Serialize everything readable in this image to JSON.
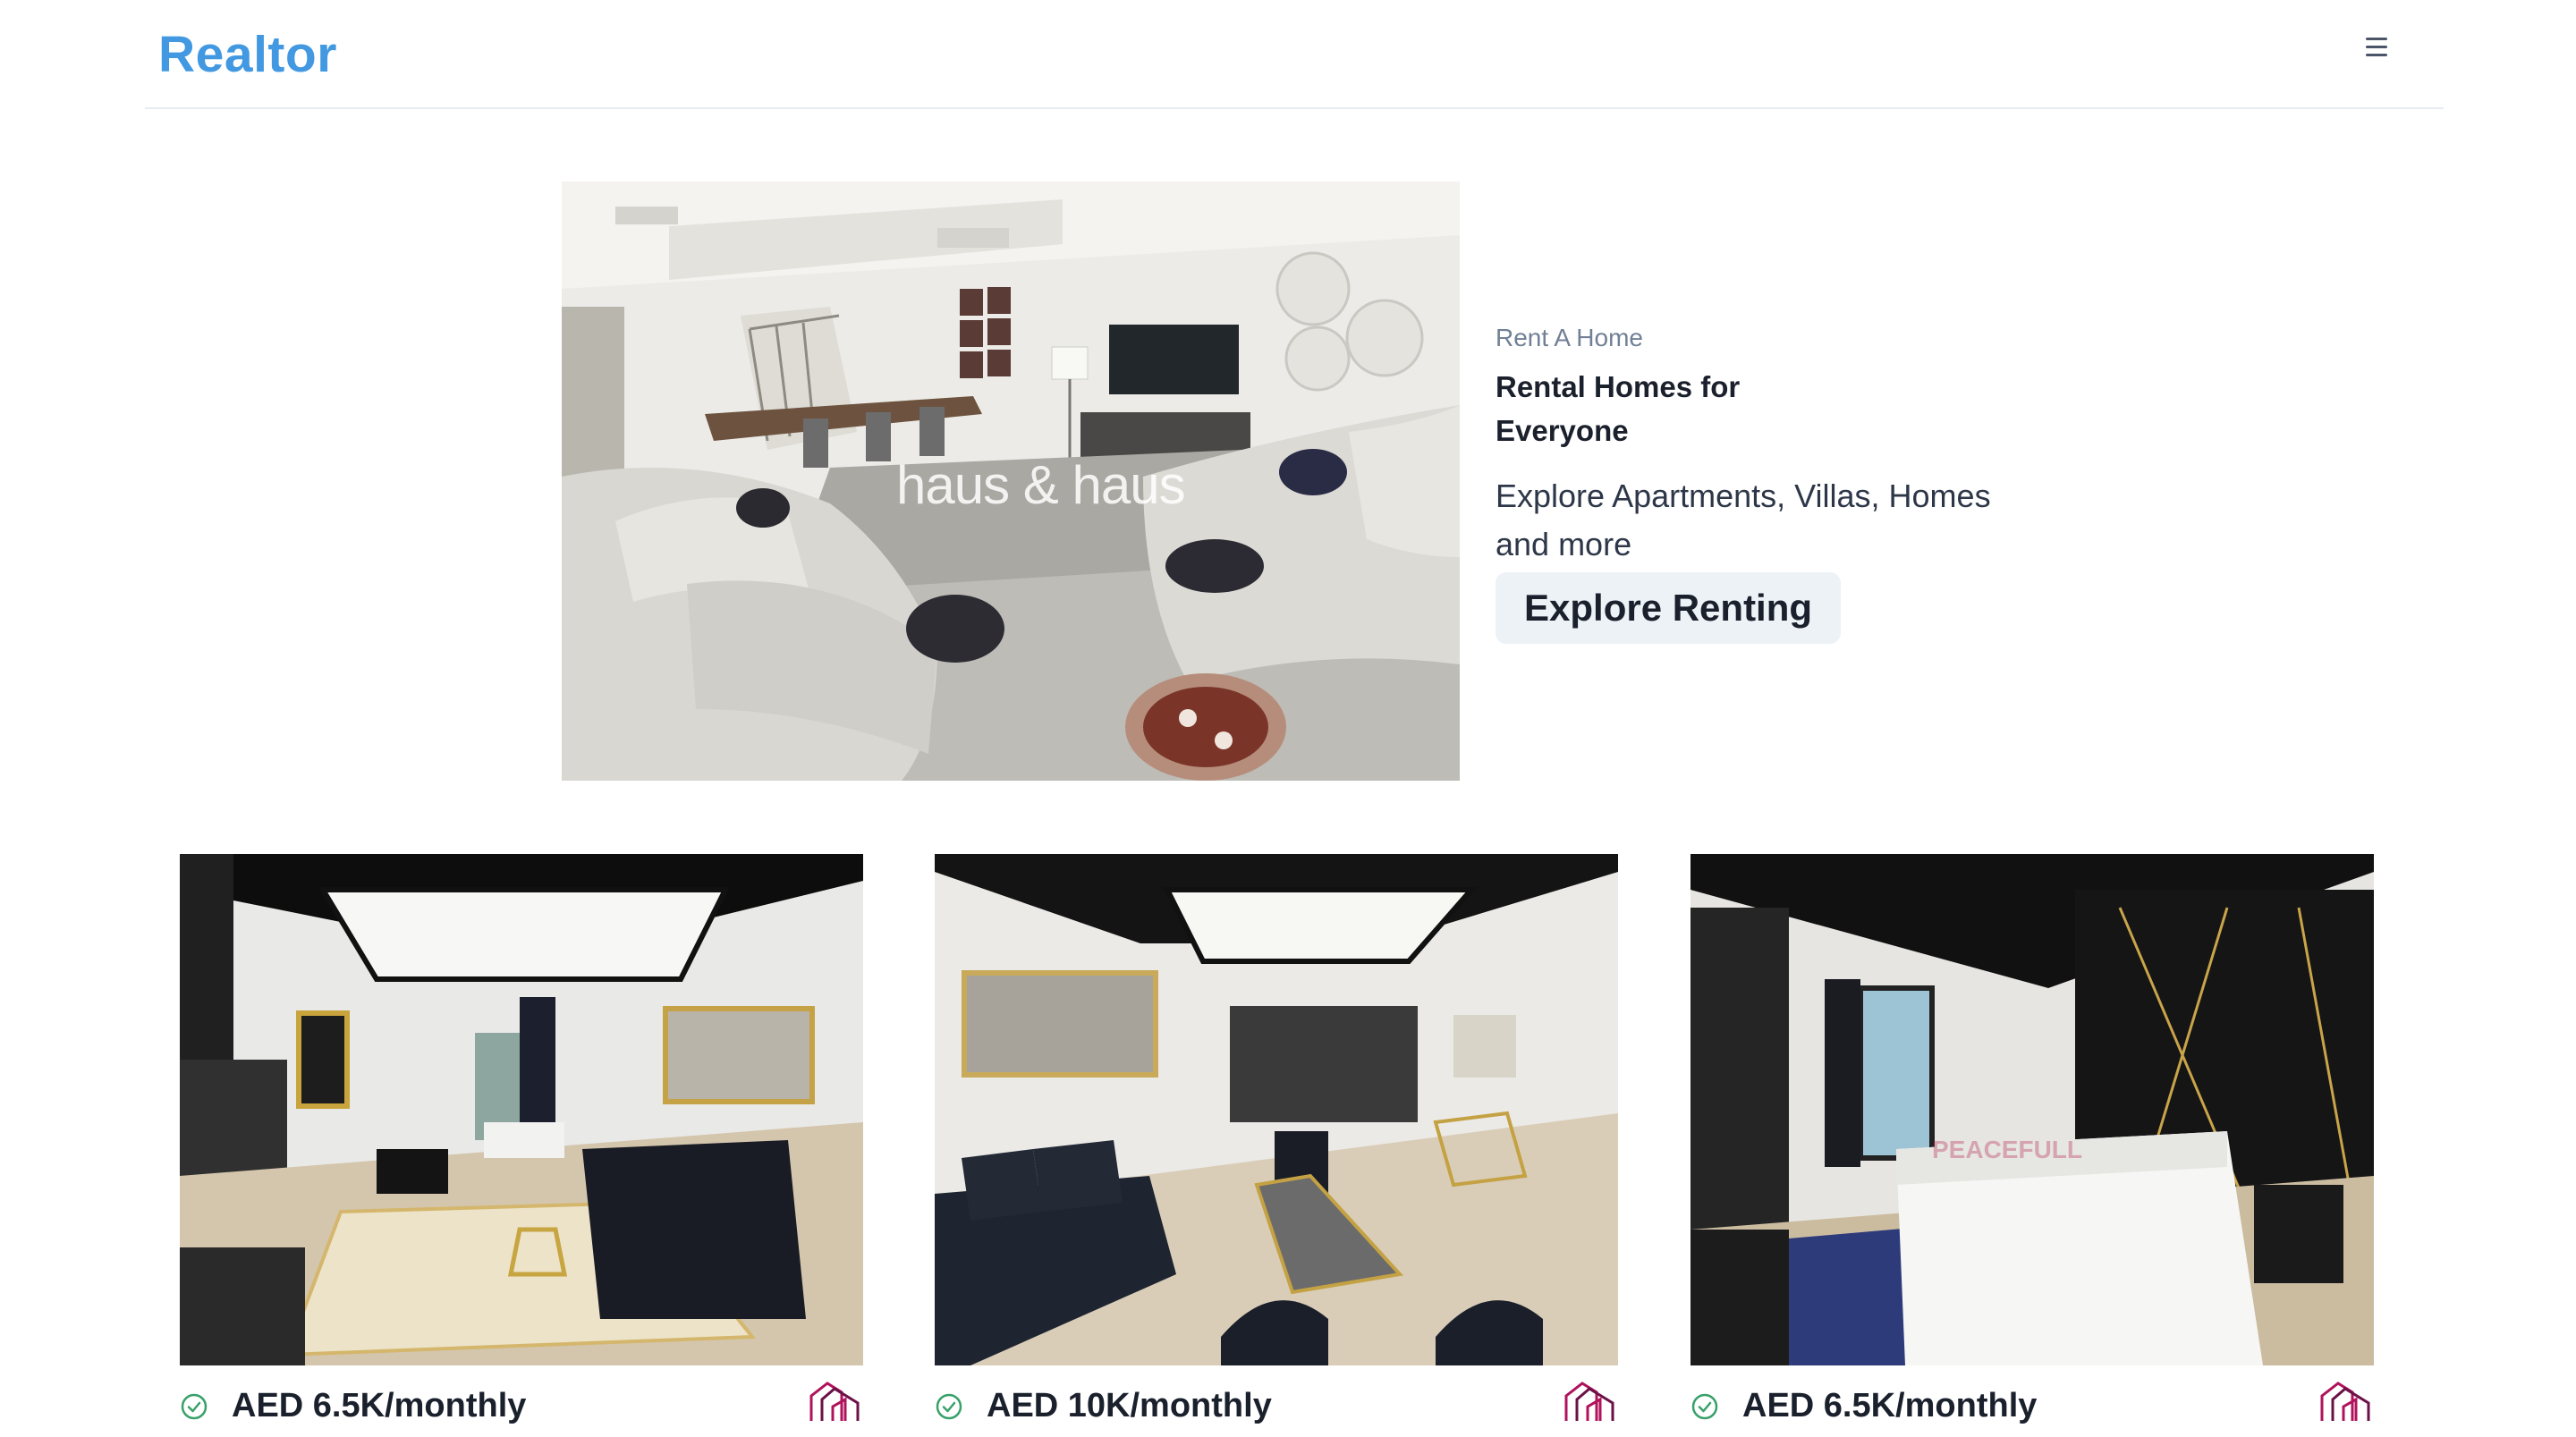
{
  "nav": {
    "brand": "Realtor",
    "menu_icon": "hamburger-menu-icon"
  },
  "hero": {
    "image_watermark": "haus & haus",
    "eyebrow": "Rent A Home",
    "title": "Rental Homes for Everyone",
    "description": "Explore Apartments, Villas, Homes and more",
    "button_label": "Explore Renting"
  },
  "listings": [
    {
      "price": "AED 6.5K/monthly",
      "verified_icon": "check-circle-icon",
      "agency_logo": "safeful-logo"
    },
    {
      "price": "AED 10K/monthly",
      "verified_icon": "check-circle-icon",
      "agency_logo": "safeful-logo"
    },
    {
      "price": "AED 6.5K/monthly",
      "verified_icon": "check-circle-icon",
      "agency_logo": "safeful-logo"
    }
  ],
  "colors": {
    "brand": "#4299e1",
    "button_bg": "#edf2f7",
    "verified_green": "#38a169",
    "agency_logo": "#b0125b"
  }
}
